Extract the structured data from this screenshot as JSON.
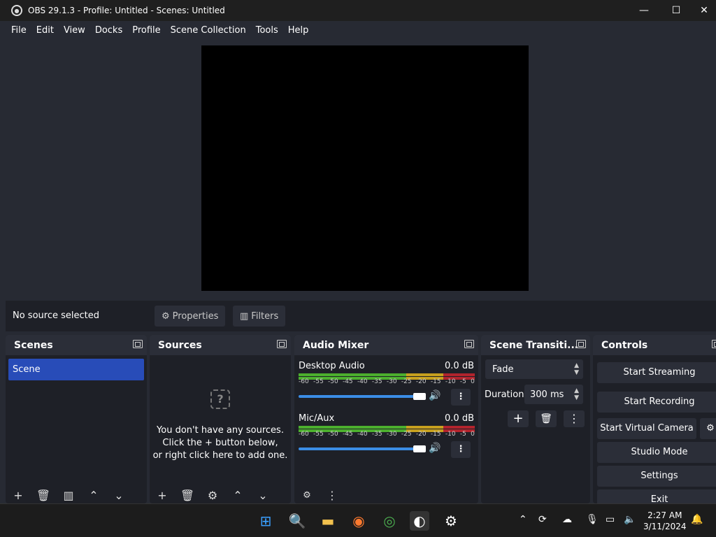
{
  "window": {
    "title": "OBS 29.1.3 - Profile: Untitled - Scenes: Untitled",
    "minimize": "—",
    "maximize": "☐",
    "close": "✕"
  },
  "menu": [
    "File",
    "Edit",
    "View",
    "Docks",
    "Profile",
    "Scene Collection",
    "Tools",
    "Help"
  ],
  "source_toolbar": {
    "status": "No source selected",
    "properties": "Properties",
    "filters": "Filters"
  },
  "docks": {
    "scenes": {
      "title": "Scenes",
      "items": [
        "Scene"
      ]
    },
    "sources": {
      "title": "Sources",
      "empty_line1": "You don't have any sources.",
      "empty_line2": "Click the + button below,",
      "empty_line3": "or right click here to add one."
    },
    "audio": {
      "title": "Audio Mixer",
      "channels": [
        {
          "name": "Desktop Audio",
          "db": "0.0 dB"
        },
        {
          "name": "Mic/Aux",
          "db": "0.0 dB"
        }
      ],
      "scale": [
        "-60",
        "-55",
        "-50",
        "-45",
        "-40",
        "-35",
        "-30",
        "-25",
        "-20",
        "-15",
        "-10",
        "-5",
        "0"
      ]
    },
    "transitions": {
      "title": "Scene Transiti...",
      "transition": "Fade",
      "duration_label": "Duration",
      "duration_value": "300 ms"
    },
    "controls": {
      "title": "Controls",
      "start_streaming": "Start Streaming",
      "start_recording": "Start Recording",
      "start_virtual_camera": "Start Virtual Camera",
      "studio_mode": "Studio Mode",
      "settings": "Settings",
      "exit": "Exit"
    }
  },
  "taskbar": {
    "time": "2:27 AM",
    "date": "3/11/2024"
  },
  "colors": {
    "accent": "#284cb8",
    "meter_green": "#4caf2e",
    "meter_yellow": "#c7a01e",
    "meter_red": "#b2242d",
    "slider": "#3b8de6"
  }
}
